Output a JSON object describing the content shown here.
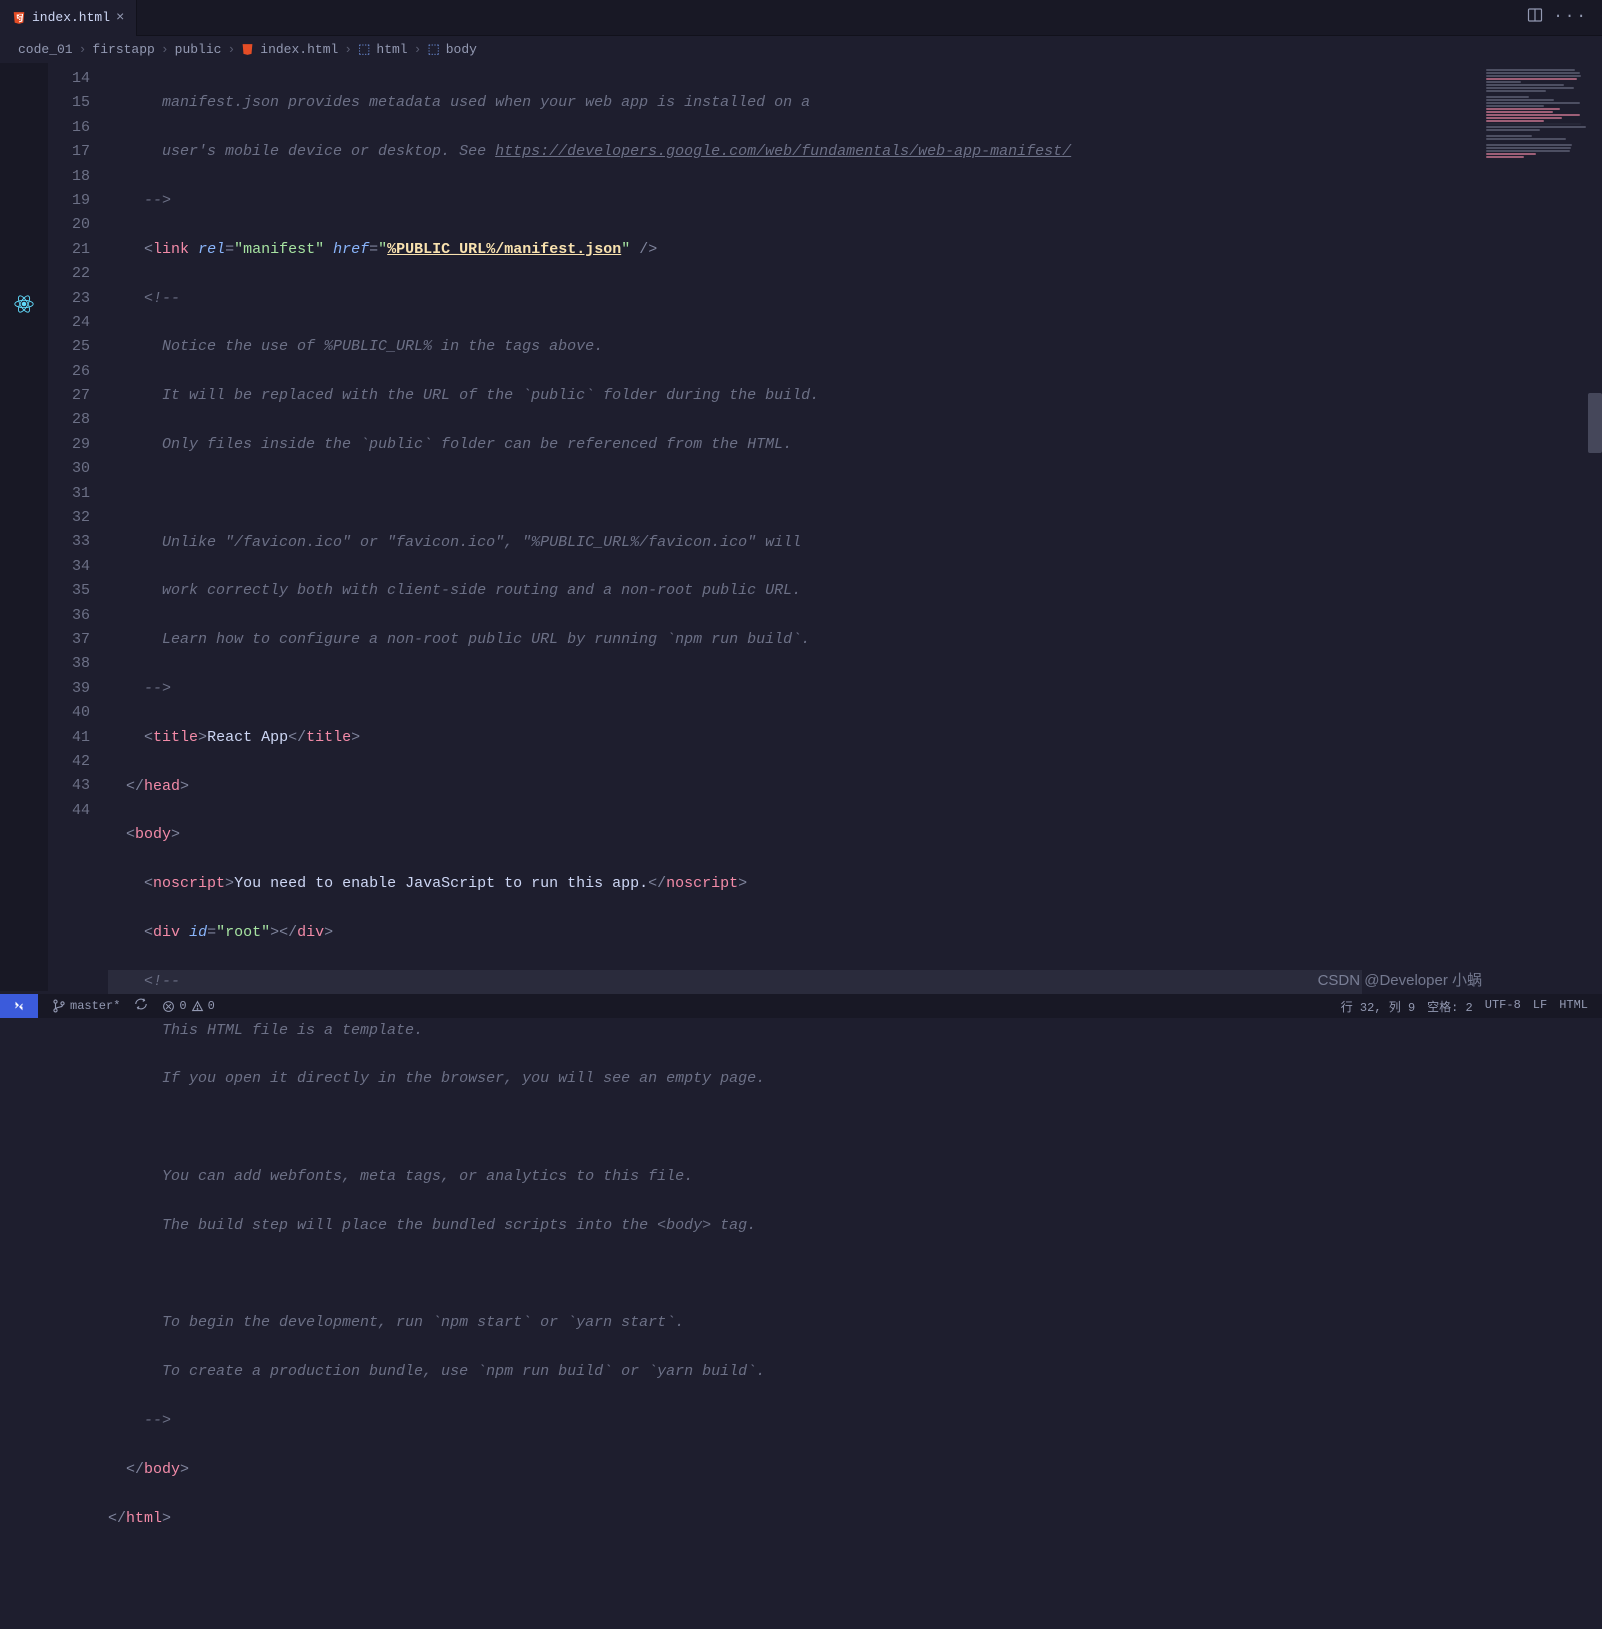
{
  "tab": {
    "filename": "index.html"
  },
  "breadcrumb": [
    "code_01",
    "firstapp",
    "public",
    "index.html",
    "html",
    "body"
  ],
  "lines": {
    "start": 14,
    "end": 44,
    "c14": "manifest.json provides metadata used when your web app is installed on a",
    "c15a": "user's mobile device or desktop. See ",
    "c15b": "https://developers.google.com/web/fundamentals/web-app-manifest/",
    "c16": "-->",
    "l17_rel": "\"manifest\"",
    "l17_href": "\"",
    "l17_url": "%PUBLIC_URL%/manifest.json",
    "l17_hrefend": "\"",
    "c18": "<!--",
    "c19": "Notice the use of %PUBLIC_URL% in the tags above.",
    "c20": "It will be replaced with the URL of the `public` folder during the build.",
    "c21": "Only files inside the `public` folder can be referenced from the HTML.",
    "c23": "Unlike \"/favicon.ico\" or \"favicon.ico\", \"%PUBLIC_URL%/favicon.ico\" will",
    "c24": "work correctly both with client-side routing and a non-root public URL.",
    "c25": "Learn how to configure a non-root public URL by running `npm run build`.",
    "c26": "-->",
    "l27_txt": "React App",
    "l30_txt": "You need to enable JavaScript to run this app.",
    "l31_id": "\"root\"",
    "c32": "<!--",
    "c33": "This HTML file is a template.",
    "c34": "If you open it directly in the browser, you will see an empty page.",
    "c36": "You can add webfonts, meta tags, or analytics to this file.",
    "c37": "The build step will place the bundled scripts into the <body> tag.",
    "c39": "To begin the development, run `npm start` or `yarn start`.",
    "c40": "To create a production bundle, use `npm run build` or `yarn build`.",
    "c41": "-->"
  },
  "statusbar": {
    "branch": "master*",
    "errors": "0",
    "warnings": "0",
    "pos": "行 32, 列 9",
    "spaces": "空格: 2",
    "encoding": "UTF-8",
    "eol": "LF",
    "lang": "HTML"
  },
  "watermark": "CSDN @Developer 小蜗"
}
